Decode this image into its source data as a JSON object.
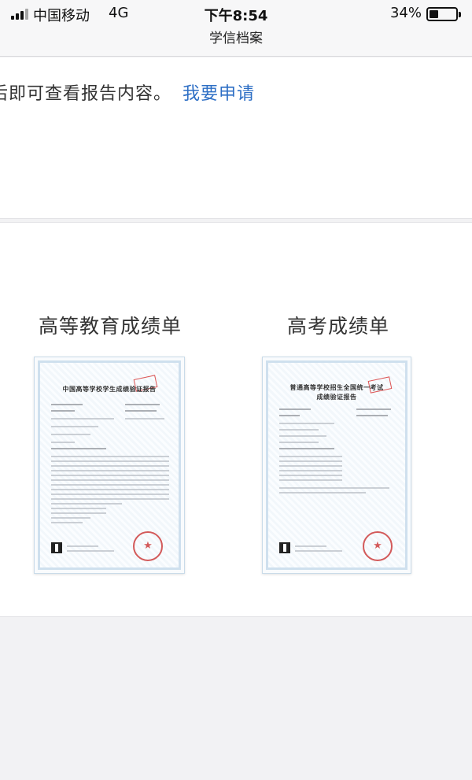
{
  "status_bar": {
    "carrier": "中国移动",
    "network": "4G",
    "time": "下午8:54",
    "battery": "34%",
    "battery_level": 0.34
  },
  "nav": {
    "title": "学信档案"
  },
  "notice": {
    "text": "后即可查看报告内容。",
    "link": "我要申请"
  },
  "cards": [
    {
      "title": "高等教育成绩单",
      "doc_heading": "中国高等学校学生成绩验证报告"
    },
    {
      "title": "高考成绩单",
      "doc_heading_line1": "普通高等学校招生全国统一考试",
      "doc_heading_line2": "成绩验证报告"
    }
  ],
  "colors": {
    "link": "#2e6fc5",
    "background": "#f2f2f4",
    "stamp": "#d35a5a"
  }
}
